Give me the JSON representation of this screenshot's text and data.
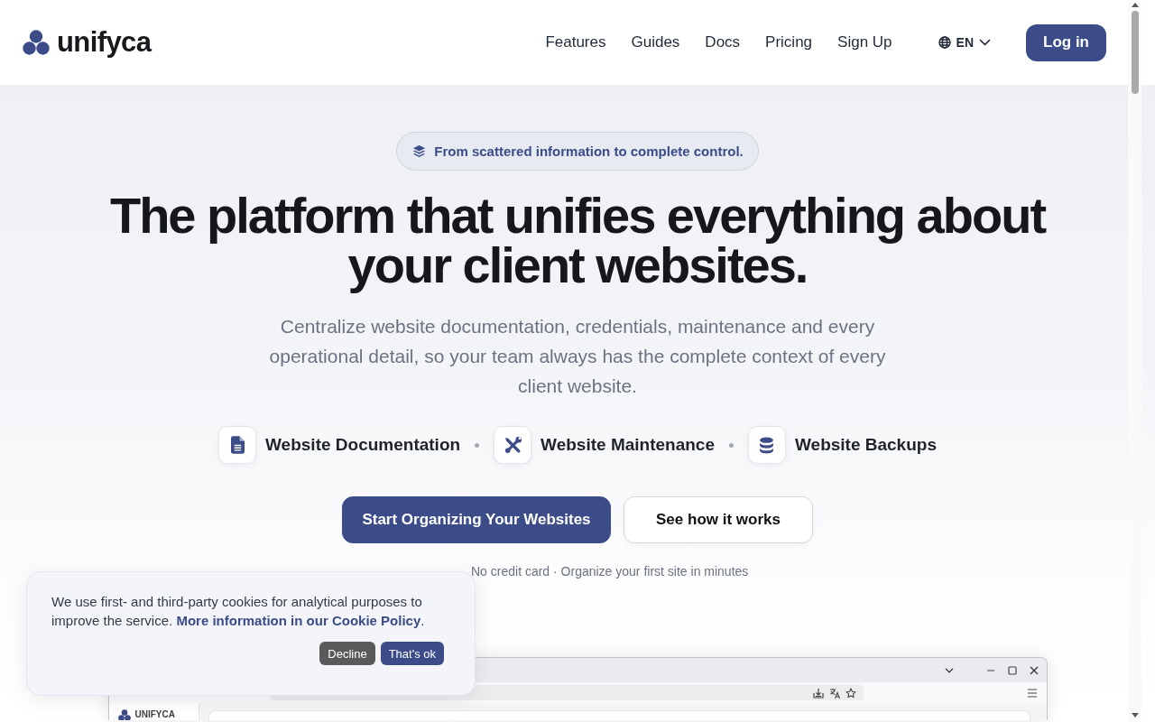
{
  "header": {
    "logo": "unifyca",
    "nav": [
      "Features",
      "Guides",
      "Docs",
      "Pricing",
      "Sign Up"
    ],
    "language": "EN",
    "login_button": "Log in"
  },
  "hero": {
    "badge": "From scattered information to complete control.",
    "headline": "The platform that unifies everything about your client websites.",
    "subtitle": "Centralize website documentation, credentials, maintenance and every operational detail, so your team always has the complete context of every client website.",
    "features": [
      {
        "kind": "document",
        "label": "Website Documentation"
      },
      {
        "kind": "tools",
        "label": "Website Maintenance"
      },
      {
        "kind": "database",
        "label": "Website Backups"
      }
    ],
    "buttons": [
      {
        "kind": "primary",
        "label": "Start Organizing Your Websites"
      },
      {
        "kind": "secondary",
        "label": "See how it works"
      }
    ],
    "hint": "No credit card · Organize your first site in minutes"
  },
  "app_preview": {
    "sidebar_logo": "UNIFYCA"
  },
  "cookie_banner": {
    "text": "We use first- and third-party cookies for analytical purposes to improve the service.",
    "link": "More information in our Cookie Policy",
    "link_suffix": ".",
    "buttons": [
      {
        "kind": "decline",
        "label": "Decline"
      },
      {
        "kind": "accept",
        "label": "That's ok"
      }
    ]
  }
}
